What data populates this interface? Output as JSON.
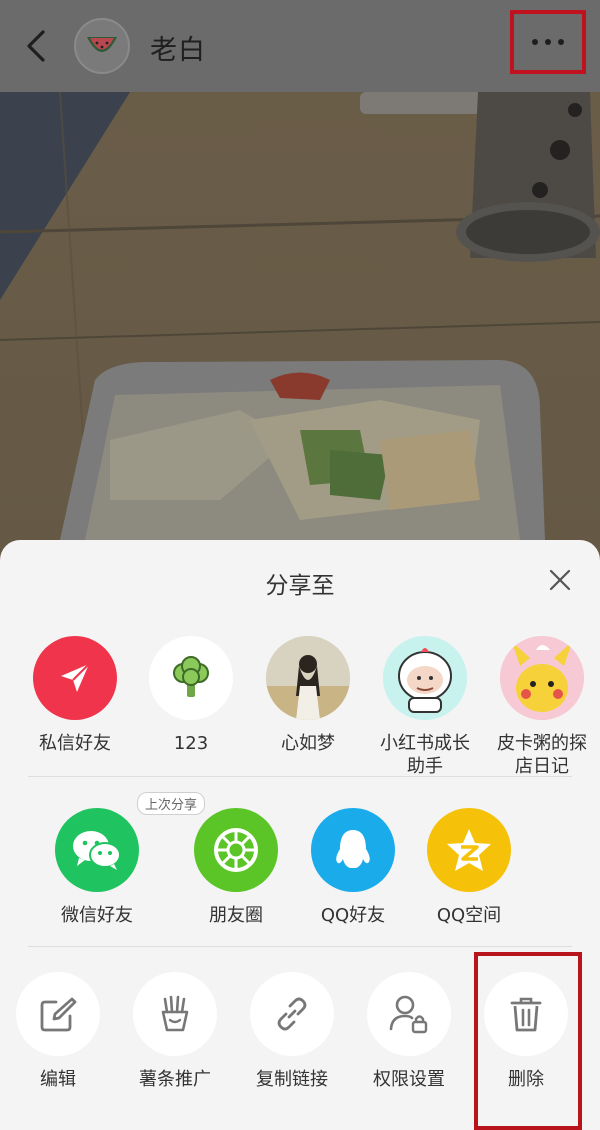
{
  "header": {
    "title": "老白"
  },
  "share_sheet": {
    "title": "分享至",
    "contacts": [
      {
        "label": "私信好友",
        "icon": "paper-plane-icon",
        "color": "#f0344c"
      },
      {
        "label": "123",
        "icon": "broccoli-icon",
        "color": "#ffffff"
      },
      {
        "label": "心如梦",
        "icon": "user-photo-girl"
      },
      {
        "label": "小红书成长助手",
        "line1": "小红书成长",
        "line2": "助手",
        "icon": "astronaut-avatar"
      },
      {
        "label": "皮卡粥的探店日记",
        "line1": "皮卡粥的探",
        "line2": "店日记",
        "icon": "pikachu-avatar"
      }
    ],
    "platforms": [
      {
        "label": "微信好友",
        "icon": "wechat-icon",
        "color": "#1fc35f",
        "badge": "上次分享"
      },
      {
        "label": "朋友圈",
        "icon": "moments-icon",
        "color": "#5bc528"
      },
      {
        "label": "QQ好友",
        "icon": "qq-icon",
        "color": "#1aabeb"
      },
      {
        "label": "QQ空间",
        "icon": "qzone-icon",
        "color": "#f5c209"
      }
    ],
    "actions": [
      {
        "label": "编辑",
        "icon": "edit-icon"
      },
      {
        "label": "薯条推广",
        "icon": "fries-icon"
      },
      {
        "label": "复制链接",
        "icon": "link-icon"
      },
      {
        "label": "权限设置",
        "icon": "user-lock-icon"
      },
      {
        "label": "删除",
        "icon": "trash-icon"
      }
    ]
  },
  "colors": {
    "highlight": "#c0121e",
    "sheet_bg": "#f4f4f4"
  }
}
